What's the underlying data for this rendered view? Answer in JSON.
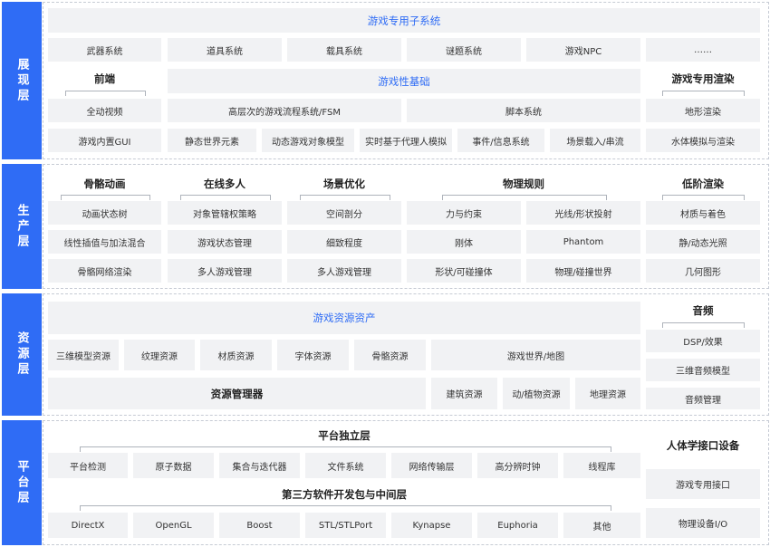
{
  "layers": [
    {
      "label": "展现层"
    },
    {
      "label": "生产层"
    },
    {
      "label": "资源层"
    },
    {
      "label": "平台层"
    }
  ],
  "presentation": {
    "title": "游戏专用子系统",
    "row1": [
      "武器系统",
      "道具系统",
      "载具系统",
      "谜题系统",
      "游戏NPC",
      "……"
    ],
    "frontend": "前端",
    "gameplay": "游戏性基础",
    "render": "游戏专用渲染",
    "row2": [
      "全动视频",
      "高层次的游戏流程系统/FSM",
      "脚本系统",
      "地形渲染"
    ],
    "row3": [
      "游戏内置GUI",
      "静态世界元素",
      "动态游戏对象模型",
      "实时基于代理人模拟",
      "事件/信息系统",
      "场景载入/串流",
      "水体模拟与渲染"
    ]
  },
  "production": {
    "headers": [
      "骨骼动画",
      "在线多人",
      "场景优化",
      "物理规则",
      "低阶渲染"
    ],
    "row1": [
      "动画状态树",
      "对象管辖权策略",
      "空间剖分",
      "力与约束",
      "光线/形状投射",
      "材质与着色"
    ],
    "row2": [
      "线性插值与加法混合",
      "游戏状态管理",
      "细致程度",
      "刚体",
      "Phantom",
      "静/动态光照"
    ],
    "row3": [
      "骨骼网络渲染",
      "多人游戏管理",
      "多人游戏管理",
      "形状/可碰撞体",
      "物理/碰撞世界",
      "几何图形"
    ]
  },
  "resource": {
    "title": "游戏资源资产",
    "row1": [
      "三维模型资源",
      "纹理资源",
      "材质资源",
      "字体资源",
      "骨骼资源",
      "游戏世界/地图"
    ],
    "manager": "资源管理器",
    "row2": [
      "建筑资源",
      "动/植物资源",
      "地理资源"
    ],
    "audio": "音频",
    "audio_items": [
      "DSP/效果",
      "三维音频模型",
      "音频管理"
    ]
  },
  "platform": {
    "independent": "平台独立层",
    "row1": [
      "平台检测",
      "原子数据",
      "集合与迭代器",
      "文件系统",
      "网络传输层",
      "高分辨时钟",
      "线程库"
    ],
    "thirdparty": "第三方软件开发包与中间层",
    "row2": [
      "DirectX",
      "OpenGL",
      "Boost",
      "STL/STLPort",
      "Kynapse",
      "Euphoria",
      "其他"
    ],
    "hid": "人体学接口设备",
    "hid_items": [
      "游戏专用接口",
      "物理设备I/O"
    ]
  }
}
